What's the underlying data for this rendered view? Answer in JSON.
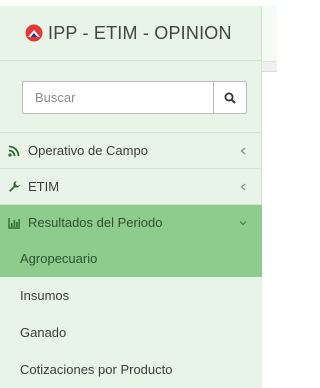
{
  "brand": {
    "title": "IPP - ETIM - OPINION"
  },
  "search": {
    "placeholder": "Buscar",
    "icon": "search-icon"
  },
  "menu": {
    "items": [
      {
        "label": "Operativo de Campo",
        "icon": "rss-icon",
        "expanded": false
      },
      {
        "label": "ETIM",
        "icon": "wrench-icon",
        "expanded": false
      },
      {
        "label": "Resultados del Periodo",
        "icon": "bar-chart-icon",
        "expanded": true
      }
    ],
    "submenu": [
      {
        "label": "Agropecuario",
        "selected": true
      },
      {
        "label": "Insumos",
        "selected": false
      },
      {
        "label": "Ganado",
        "selected": false
      },
      {
        "label": "Cotizaciones por Producto",
        "selected": false
      }
    ]
  },
  "colors": {
    "sidebar_bg": "#e8f4e8",
    "active_bg": "#8ecc8e",
    "logo_red": "#e53935",
    "logo_blue": "#1e3f8a"
  }
}
